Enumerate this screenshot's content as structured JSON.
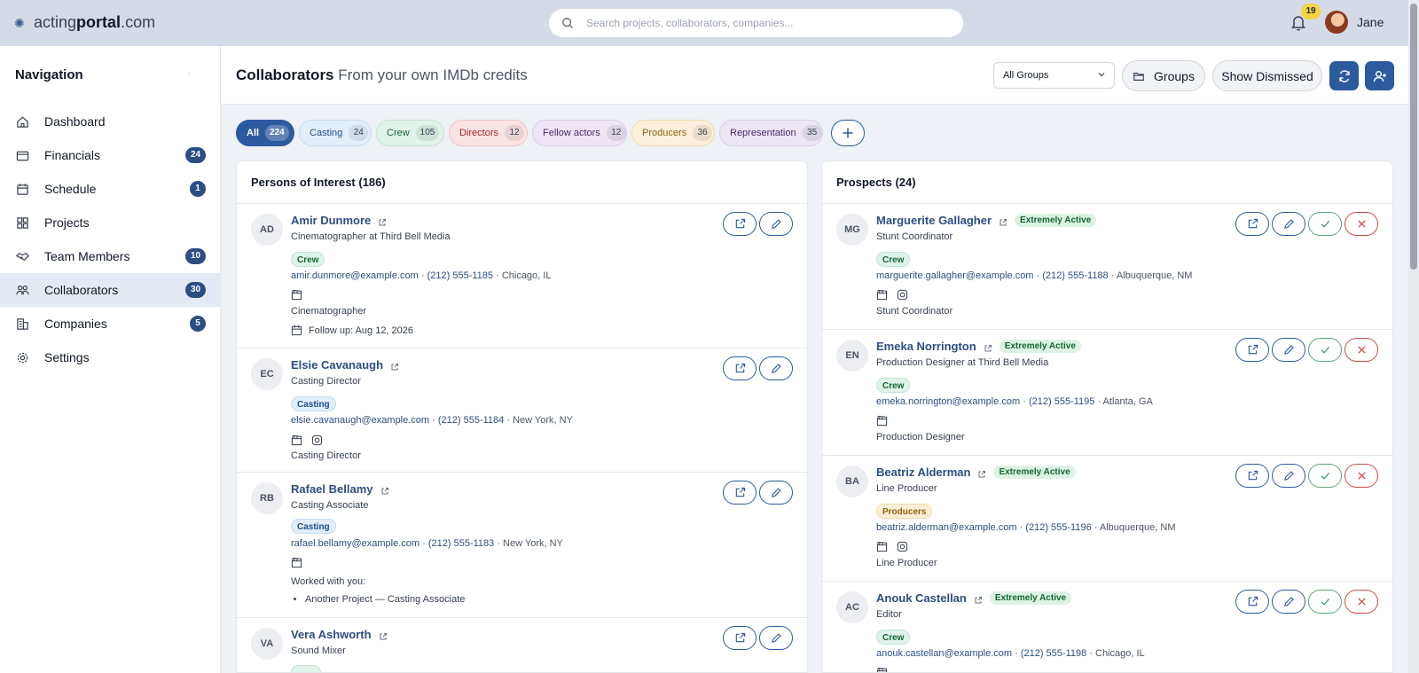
{
  "app": {
    "logo_prefix": "acting",
    "logo_bold": "portal",
    "logo_suffix": ".com",
    "search_placeholder": "Search projects, collaborators, companies...",
    "notifications": "19",
    "user_name": "Jane"
  },
  "sidebar": {
    "title": "Navigation",
    "items": [
      {
        "label": "Dashboard",
        "badge": "",
        "icon": "home-icon"
      },
      {
        "label": "Financials",
        "badge": "24",
        "icon": "wallet-icon"
      },
      {
        "label": "Schedule",
        "badge": "1",
        "icon": "calendar-icon"
      },
      {
        "label": "Projects",
        "badge": "",
        "icon": "grid-icon"
      },
      {
        "label": "Team Members",
        "badge": "10",
        "icon": "handshake-icon"
      },
      {
        "label": "Collaborators",
        "badge": "30",
        "icon": "people-icon"
      },
      {
        "label": "Companies",
        "badge": "5",
        "icon": "building-icon"
      },
      {
        "label": "Settings",
        "badge": "",
        "icon": "gear-icon"
      }
    ]
  },
  "header": {
    "title": "Collaborators",
    "subtitle": "From your own IMDb credits",
    "group_select": "All Groups",
    "groups_label": "Groups",
    "dismissed_label": "Show Dismissed"
  },
  "filters": [
    {
      "label": "All",
      "count": "224"
    },
    {
      "label": "Casting",
      "count": "24"
    },
    {
      "label": "Crew",
      "count": "105"
    },
    {
      "label": "Directors",
      "count": "12"
    },
    {
      "label": "Fellow actors",
      "count": "12"
    },
    {
      "label": "Producers",
      "count": "36"
    },
    {
      "label": "Representation",
      "count": "35"
    }
  ],
  "colors": {
    "primary": "#2c4e84",
    "accent_blue": "#2c5a9e",
    "active_status": "#dcf3e3"
  },
  "poi": {
    "title": "Persons of Interest (186)",
    "people": [
      {
        "initials": "AD",
        "name": "Amir Dunmore",
        "role": "Cinematographer at Third Bell Media",
        "tag": "Crew",
        "email": "amir.dunmore@example.com",
        "phone": "(212) 555-1185",
        "location": "Chicago, IL",
        "note": "Cinematographer",
        "followup": "Follow up: Aug 12, 2026"
      },
      {
        "initials": "EC",
        "name": "Elsie Cavanaugh",
        "role": "Casting Director",
        "tag": "Casting",
        "email": "elsie.cavanaugh@example.com",
        "phone": "(212) 555-1184",
        "location": "New York, NY",
        "note": "Casting Director"
      },
      {
        "initials": "RB",
        "name": "Rafael Bellamy",
        "role": "Casting Associate",
        "tag": "Casting",
        "email": "rafael.bellamy@example.com",
        "phone": "(212) 555-1183",
        "location": "New York, NY",
        "worked_title": "Worked with you:",
        "worked_item": "Another Project — Casting Associate"
      },
      {
        "initials": "VA",
        "name": "Vera Ashworth",
        "role": "Sound Mixer"
      }
    ]
  },
  "prospects": {
    "title": "Prospects (24)",
    "people": [
      {
        "initials": "MG",
        "name": "Marguerite Gallagher",
        "status": "Extremely Active",
        "role": "Stunt Coordinator",
        "tag": "Crew",
        "email": "marguerite.gallagher@example.com",
        "phone": "(212) 555-1188",
        "location": "Albuquerque, NM",
        "note": "Stunt Coordinator"
      },
      {
        "initials": "EN",
        "name": "Emeka Norrington",
        "status": "Extremely Active",
        "role": "Production Designer at Third Bell Media",
        "tag": "Crew",
        "email": "emeka.norrington@example.com",
        "phone": "(212) 555-1195",
        "location": "Atlanta, GA",
        "note": "Production Designer"
      },
      {
        "initials": "BA",
        "name": "Beatriz Alderman",
        "status": "Extremely Active",
        "role": "Line Producer",
        "tag": "Producers",
        "email": "beatriz.alderman@example.com",
        "phone": "(212) 555-1196",
        "location": "Albuquerque, NM",
        "note": "Line Producer"
      },
      {
        "initials": "AC",
        "name": "Anouk Castellan",
        "status": "Extremely Active",
        "role": "Editor",
        "tag": "Crew",
        "email": "anouk.castellan@example.com",
        "phone": "(212) 555-1198",
        "location": "Chicago, IL"
      }
    ]
  }
}
